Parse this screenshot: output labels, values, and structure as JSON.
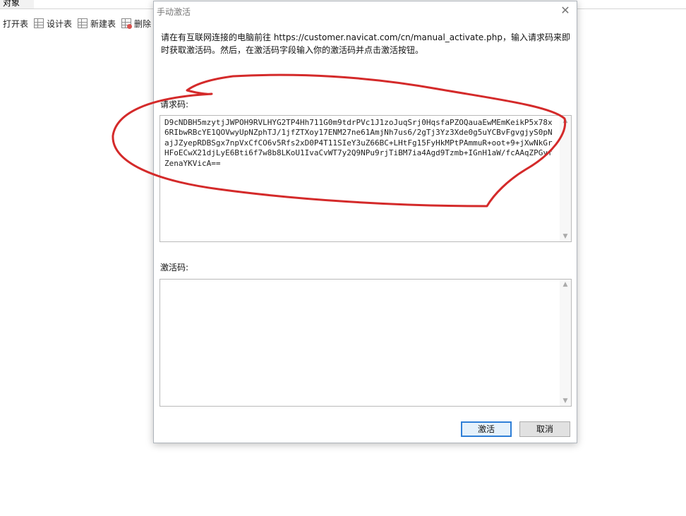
{
  "background": {
    "tab_label": "对象",
    "toolbar": [
      {
        "label": "打开表",
        "icon": "open-table-icon"
      },
      {
        "label": "设计表",
        "icon": "design-table-icon"
      },
      {
        "label": "新建表",
        "icon": "new-table-icon"
      },
      {
        "label": "删除",
        "icon": "delete-table-icon"
      }
    ]
  },
  "dialog": {
    "title": "手动激活",
    "instruction": "请在有互联网连接的电脑前往 https://customer.navicat.com/cn/manual_activate.php，输入请求码来即时获取激活码。然后，在激活码字段输入你的激活码并点击激活按钮。",
    "request_label": "请求码:",
    "request_code": "D9cNDBH5mzytjJWPOH9RVLHYG2TP4Hh711G0m9tdrPVc1J1zoJuqSrj0HqsfaPZOQauaEwMEmKeikP5x78x6RIbwRBcYE1QOVwyUpNZphTJ/1jfZTXoy17ENM27ne61AmjNh7us6/2gTj3Yz3Xde0g5uYCBvFgvgjyS0pNajJZyepRDBSgx7npVxCfCO6v5Rfs2xD0P4T11SIeY3uZ66BC+LHtFg15FyHkMPtPAmmuR+oot+9+jXwNkGrHFoECwX21djLyE6Bti6f7w8b8LKoU1IvaCvWT7y2Q9NPu9rjTiBM7ia4Agd9Tzmb+IGnH1aW/fcAAqZPGyfZenaYKVicA==",
    "activation_label": "激活码:",
    "activation_value": "",
    "activate_button": "激活",
    "cancel_button": "取消"
  },
  "annotation": {
    "stroke_color": "#d42a2a"
  },
  "colors": {
    "primary_border": "#2f7fd7"
  }
}
